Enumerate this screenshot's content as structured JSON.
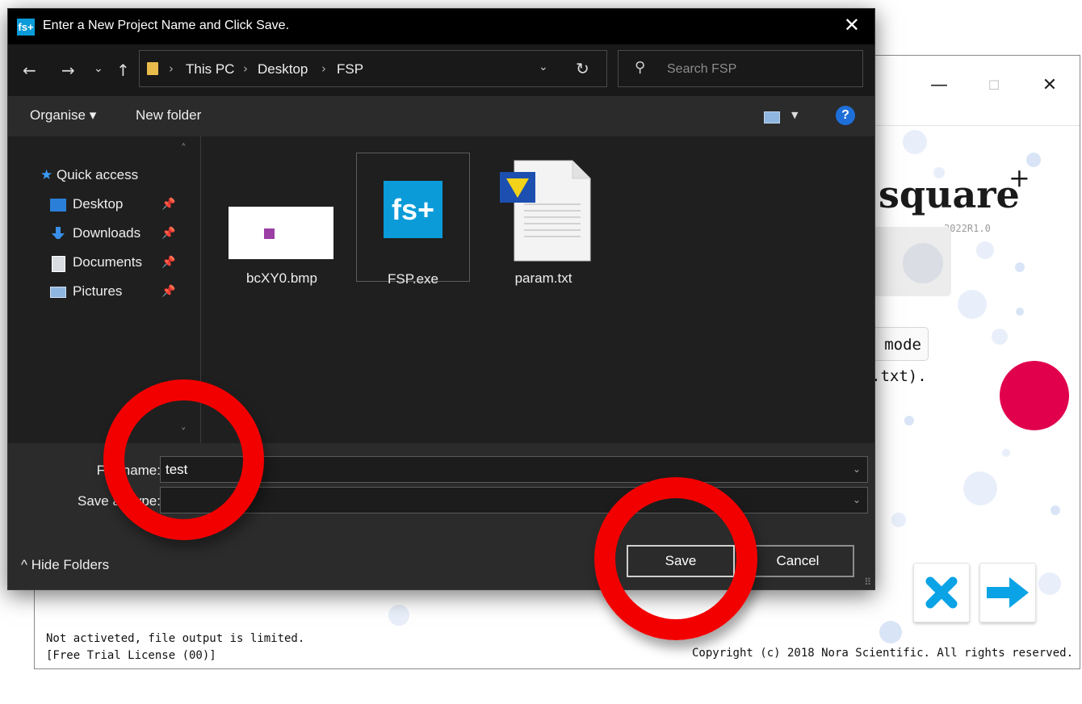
{
  "app": {
    "window_controls": {
      "minimize": "—",
      "maximize": "☐",
      "close": "✕"
    },
    "logo_text": "square",
    "logo_plus": "+",
    "version": "2022R1.0",
    "mode_button_fragment": "mode",
    "param_hint_fragment": ".txt).",
    "status_line1": "Not activeted, file output is limited.",
    "status_line2": "[Free Trial License (00)]",
    "copyright": "Copyright (c) 2018 Nora Scientific. All rights reserved.",
    "colors": {
      "accent_red": "#e1004c",
      "action_blue": "#0aa3e6"
    }
  },
  "dialog": {
    "icon_text": "fs+",
    "title": "Enter a New Project Name and Click Save.",
    "close_label": "✕",
    "nav": {
      "back": "←",
      "forward": "→",
      "history": "⌄",
      "up": "↑",
      "breadcrumb": [
        "This PC",
        "Desktop",
        "FSP"
      ],
      "separator": "›",
      "dropdown": "⌄",
      "refresh": "↻",
      "search_icon": "⚲",
      "search_placeholder": "Search FSP"
    },
    "toolbar": {
      "organise": "Organise ▾",
      "new_folder": "New folder",
      "view_dropdown": "▼",
      "help": "?"
    },
    "nav_pane": {
      "quick_access": "Quick access",
      "items": [
        {
          "label": "Desktop",
          "icon": "desktop-icon"
        },
        {
          "label": "Downloads",
          "icon": "download-arrow-icon"
        },
        {
          "label": "Documents",
          "icon": "document-icon"
        },
        {
          "label": "Pictures",
          "icon": "picture-icon"
        }
      ],
      "pin": "📌",
      "scroll_up": "˄",
      "scroll_down": "˅"
    },
    "files": [
      {
        "name": "bcXY0.bmp",
        "icon": "bitmap-thumbnail"
      },
      {
        "name": "FSP.exe",
        "icon": "fs-plus-app-icon",
        "icon_text": "fs+"
      },
      {
        "name": "param.txt",
        "icon": "text-file-icon"
      }
    ],
    "filename_label": "File name:",
    "filename_value": "test",
    "savetype_label": "Save as type:",
    "savetype_value": "",
    "combo_arrow": "⌄",
    "hide_folders": "^  Hide Folders",
    "save_button": "Save",
    "cancel_button": "Cancel"
  }
}
